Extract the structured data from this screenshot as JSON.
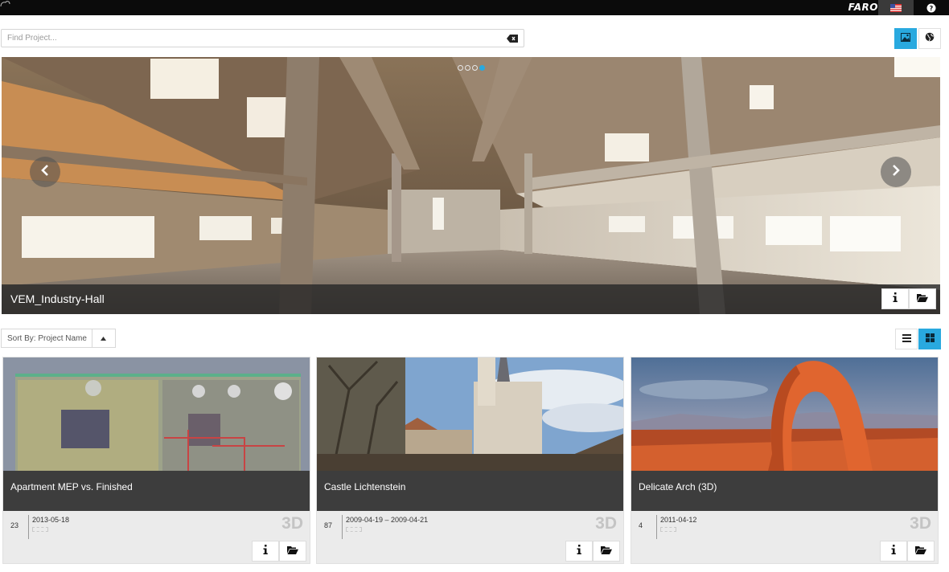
{
  "topbar": {
    "logo": "FARO",
    "icons": {
      "home": "cloud-home-icon",
      "flag": "us-flag-icon",
      "help": "help-icon"
    }
  },
  "search": {
    "placeholder": "Find Project..."
  },
  "view_modes": {
    "active": "image",
    "options": [
      "image-icon",
      "globe-icon"
    ]
  },
  "hero": {
    "title": "VEM_Industry-Hall",
    "slide_count": 4,
    "active_slide": 4
  },
  "sort": {
    "label": "Sort By: Project Name"
  },
  "layout_modes": {
    "active": "grid",
    "options": [
      "list-icon",
      "grid-icon"
    ]
  },
  "projects": [
    {
      "name": "Apartment MEP vs. Finished",
      "count": "23",
      "date": "2013-05-18",
      "type": "3D"
    },
    {
      "name": "Castle Lichtenstein",
      "count": "87",
      "date": "2009-04-19 – 2009-04-21",
      "type": "3D"
    },
    {
      "name": "Delicate Arch (3D)",
      "count": "4",
      "date": "2011-04-12",
      "type": "3D"
    }
  ],
  "colors": {
    "accent": "#29a9df",
    "topbar": "#0b0b0b",
    "caption": "#3d3d3d"
  }
}
